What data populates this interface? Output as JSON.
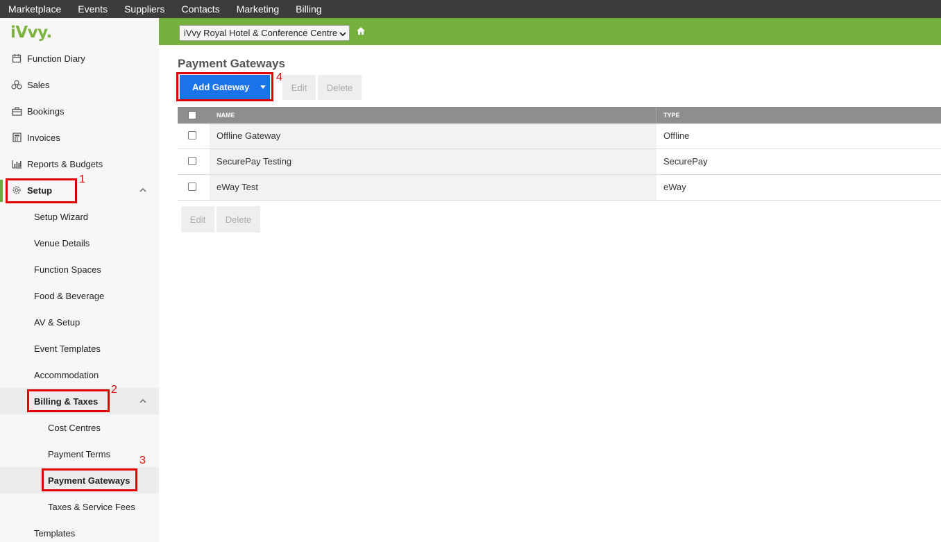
{
  "topnav": {
    "items": [
      "Marketplace",
      "Events",
      "Suppliers",
      "Contacts",
      "Marketing",
      "Billing"
    ]
  },
  "sidebar": {
    "logo": "iVvy.",
    "items": [
      {
        "label": "Function Diary",
        "icon": "calendar-icon"
      },
      {
        "label": "Sales",
        "icon": "sales-icon"
      },
      {
        "label": "Bookings",
        "icon": "briefcase-icon"
      },
      {
        "label": "Invoices",
        "icon": "calculator-icon"
      },
      {
        "label": "Reports & Budgets",
        "icon": "bar-chart-icon"
      },
      {
        "label": "Setup",
        "icon": "gear-icon"
      },
      {
        "label": "Setup Wizard"
      },
      {
        "label": "Venue Details"
      },
      {
        "label": "Function Spaces"
      },
      {
        "label": "Food & Beverage"
      },
      {
        "label": "AV & Setup"
      },
      {
        "label": "Event Templates"
      },
      {
        "label": "Accommodation"
      },
      {
        "label": "Billing & Taxes"
      },
      {
        "label": "Cost Centres"
      },
      {
        "label": "Payment Terms"
      },
      {
        "label": "Payment Gateways"
      },
      {
        "label": "Taxes & Service Fees"
      },
      {
        "label": "Templates"
      }
    ]
  },
  "annotations": [
    "1",
    "2",
    "3",
    "4"
  ],
  "header": {
    "venue": "iVvy Royal Hotel & Conference Centre"
  },
  "main": {
    "title": "Payment Gateways",
    "add_button": "Add Gateway",
    "edit_button": "Edit",
    "delete_button": "Delete",
    "columns": [
      "NAME",
      "TYPE"
    ],
    "rows": [
      {
        "name": "Offline Gateway",
        "type": "Offline"
      },
      {
        "name": "SecurePay Testing",
        "type": "SecurePay"
      },
      {
        "name": "eWay Test",
        "type": "eWay"
      }
    ]
  },
  "colors": {
    "accent_green": "#76b13e",
    "primary_blue": "#1a73e8",
    "annotation_red": "#e00000"
  }
}
